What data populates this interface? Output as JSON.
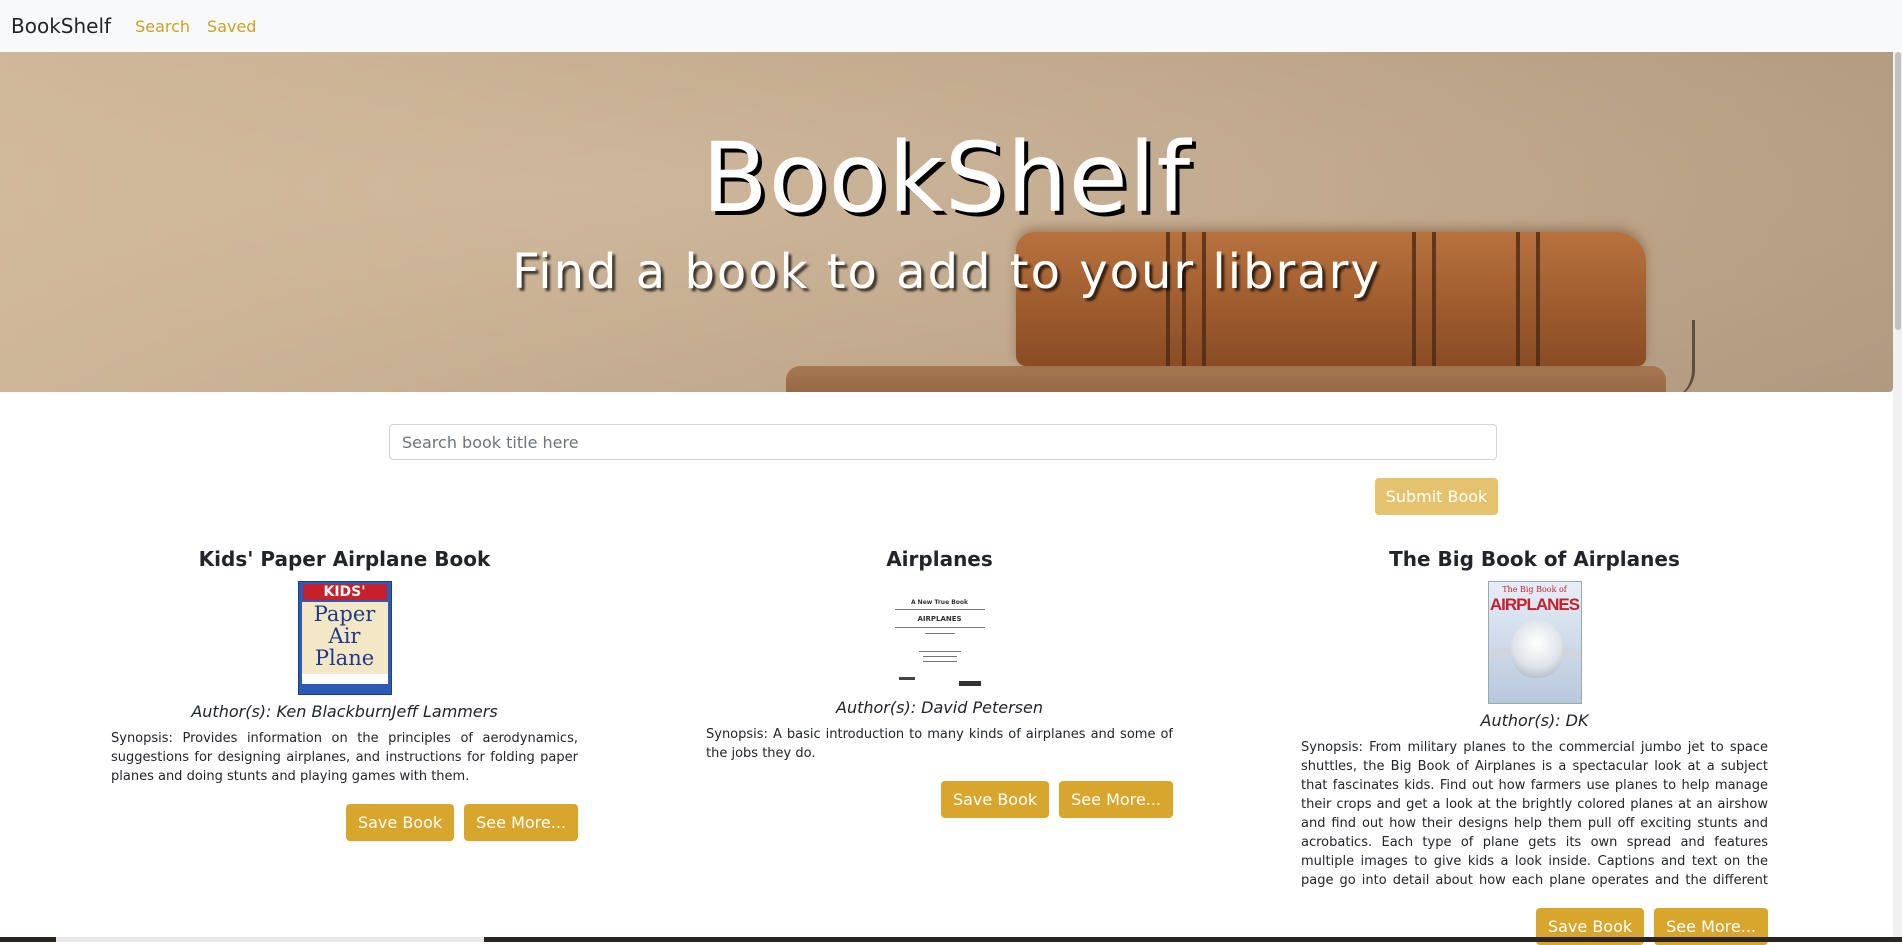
{
  "navbar": {
    "brand": "BookShelf",
    "links": [
      {
        "label": "Search"
      },
      {
        "label": "Saved"
      }
    ]
  },
  "hero": {
    "title": "BookShelf",
    "subtitle": "Find a book to add to your library"
  },
  "search": {
    "placeholder": "Search book title here",
    "value": "",
    "submit_label": "Submit Book"
  },
  "results": [
    {
      "title": "Kids' Paper Airplane Book",
      "authors": "Author(s): Ken BlackburnJeff Lammers",
      "synopsis": "Synopsis: Provides information on the principles of aerodynamics, suggestions for designing airplanes, and instructions for folding paper planes and doing stunts and playing games with them.",
      "save_label": "Save Book",
      "more_label": "See More...",
      "cover_text": {
        "top": "KIDS'",
        "line1": "Paper",
        "line2": "Air",
        "line3": "Plane"
      }
    },
    {
      "title": "Airplanes",
      "authors": "Author(s): David Petersen",
      "synopsis": "Synopsis: A basic introduction to many kinds of airplanes and some of the jobs they do.",
      "save_label": "Save Book",
      "more_label": "See More...",
      "cover_text": {
        "top": "A New True Book",
        "title": "AIRPLANES"
      }
    },
    {
      "title": "The Big Book of Airplanes",
      "authors": "Author(s): DK",
      "synopsis": "Synopsis: From military planes to the commercial jumbo jet to space shuttles, the Big Book of Airplanes is a spectacular look at a subject that fascinates kids. Find out how farmers use planes to help manage their crops and get a look at the brightly colored planes at an airshow and find out how their designs help them pull off exciting stunts and acrobatics. Each type of plane gets its own spread and features multiple images to give kids a look inside. Captions and text on the page go into detail about how each plane operates and the different tasks it performs from",
      "save_label": "Save Book",
      "more_label": "See More...",
      "cover_text": {
        "top": "The Big Book of",
        "title": "AIRPLANES"
      }
    }
  ],
  "colors": {
    "accent": "#d8a62c",
    "accent_light": "#e5c36e",
    "link": "#c9a227",
    "navbar_bg": "#f8f9fa"
  }
}
